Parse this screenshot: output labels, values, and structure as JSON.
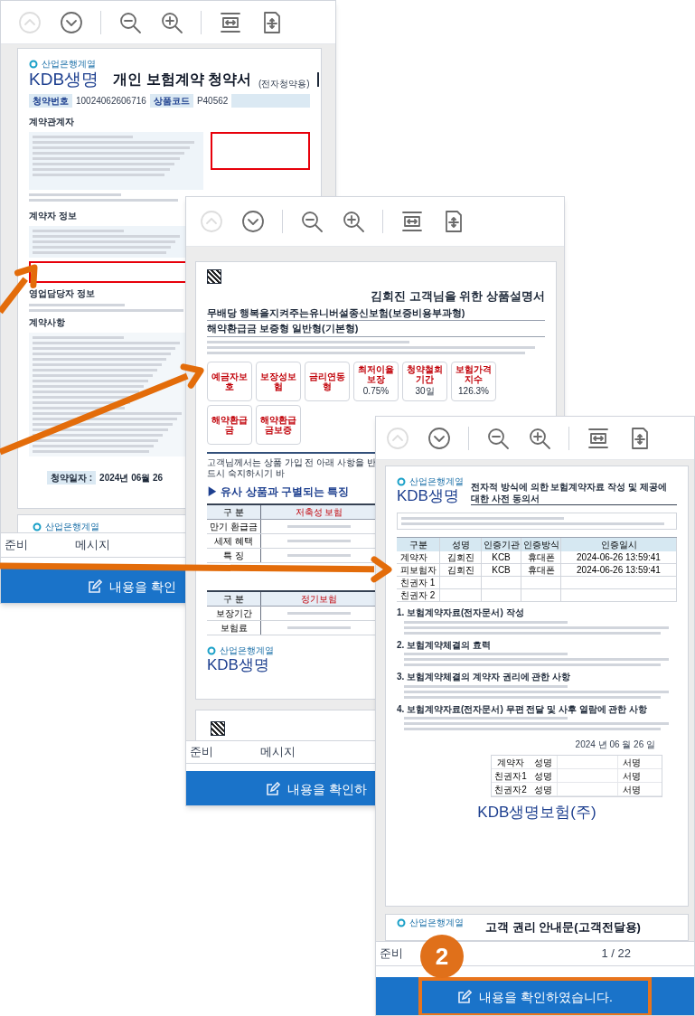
{
  "windows": [
    {
      "toolbar": [
        {
          "kind": "page-up",
          "disabled": true
        },
        {
          "kind": "page-down",
          "disabled": false
        },
        {
          "kind": "zoom-out",
          "disabled": false
        },
        {
          "kind": "zoom-in",
          "disabled": false
        },
        {
          "kind": "fit-width",
          "disabled": false
        },
        {
          "kind": "fit-page",
          "disabled": false
        }
      ],
      "document": {
        "kind": "application",
        "brand_group": "산업은행계열",
        "logo": "KDB생명",
        "title": "개인 보험계약 청약서",
        "subtitle": "(전자청약용)",
        "info": [
          {
            "label": "청약번호",
            "value": "10024062606716"
          },
          {
            "label": "상품코드",
            "value": "P40562"
          }
        ],
        "sections": [
          "계약관계자",
          "계약자 정보",
          "영업담당자 정보",
          "계약사항"
        ],
        "date_label": "청약일자 :",
        "date": "2024년 06월 26",
        "next_page_brand": "산업은행계열"
      },
      "status": {
        "left": "준비",
        "right": "메시지"
      },
      "confirm_button": {
        "label": "내용을 확인",
        "highlighted": false
      }
    },
    {
      "toolbar": [
        {
          "kind": "page-up",
          "disabled": true
        },
        {
          "kind": "page-down",
          "disabled": false
        },
        {
          "kind": "zoom-out",
          "disabled": false
        },
        {
          "kind": "zoom-in",
          "disabled": false
        },
        {
          "kind": "fit-width",
          "disabled": false
        },
        {
          "kind": "fit-page",
          "disabled": false
        }
      ],
      "document": {
        "kind": "explanation",
        "title": "김회진 고객님을 위한 상품설명서",
        "product": [
          "무배당 행복을지켜주는유니버설종신보험(보증비용부과형)",
          "해약환급금 보증형 일반형(기본형)"
        ],
        "tiles": [
          {
            "label": "예금자보호"
          },
          {
            "label": "보장성보험"
          },
          {
            "label": "금리연동형"
          },
          {
            "label": "최저이율보장",
            "value": "0.75%"
          },
          {
            "label": "청약철회기간",
            "value": "30일"
          },
          {
            "label": "보험가격지수",
            "value": "126.3%"
          },
          {
            "label": "해약환급금"
          },
          {
            "label": "해약환급금보증"
          }
        ],
        "notice": "고객님께서는 상품 가입 전 아래 사항을 반드시 숙지하시기 바",
        "feature_heading": "▶ 유사 상품과 구별되는 특징",
        "tables": [
          {
            "header": [
              "구 분",
              "저축성 보험"
            ],
            "rows": [
              "만기 환급금",
              "세제 혜택",
              "특 징"
            ]
          },
          {
            "header": [
              "구 분",
              "정기보험"
            ],
            "rows": [
              "보장기간",
              "보험료"
            ]
          }
        ],
        "footer_brand": "산업은행계열",
        "footer_logo": "KDB생명"
      },
      "status": {
        "left": "준비",
        "right": "메시지"
      },
      "confirm_button": {
        "label": "내용을 확인하",
        "highlighted": false
      }
    },
    {
      "toolbar": [
        {
          "kind": "page-up",
          "disabled": true
        },
        {
          "kind": "page-down",
          "disabled": false
        },
        {
          "kind": "zoom-out",
          "disabled": false
        },
        {
          "kind": "zoom-in",
          "disabled": false
        },
        {
          "kind": "fit-width",
          "disabled": false
        },
        {
          "kind": "fit-page",
          "disabled": false
        }
      ],
      "document": {
        "kind": "consent",
        "brand_group": "산업은행계열",
        "logo": "KDB생명",
        "title": "전자적 방식에 의한 보험계약자료 작성 및 제공에 대한 사전 동의서",
        "auth_table": {
          "header": [
            "구분",
            "성명",
            "인증기관",
            "인증방식",
            "인증일시"
          ],
          "rows": [
            {
              "role": "계약자",
              "cells": [
                "김회진",
                "KCB",
                "휴대폰",
                "2024-06-26 13:59:41"
              ]
            },
            {
              "role": "피보험자",
              "cells": [
                "김회진",
                "KCB",
                "휴대폰",
                "2024-06-26 13:59:41"
              ]
            },
            {
              "role": "친권자 1",
              "cells": []
            },
            {
              "role": "친권자 2",
              "cells": []
            }
          ]
        },
        "sections": [
          "1. 보험계약자료(전자문서) 작성",
          "2. 보험계약체결의 효력",
          "3. 보험계약체결의 계약자 권리에 관한 사항",
          "4. 보험계약자료(전자문서) 무편 전달 및 사후 열람에 관한 사항"
        ],
        "date": "2024 년 06 월 26 일",
        "signers": [
          {
            "role": "계약자",
            "name_label": "성명",
            "sign_label": "서명"
          },
          {
            "role": "친권자1",
            "name_label": "성명",
            "sign_label": "서명"
          },
          {
            "role": "친권자2",
            "name_label": "성명",
            "sign_label": "서명"
          }
        ],
        "company": "KDB생명보험(주)",
        "next_page_brand": "산업은행계열",
        "next_page_title": "고객 권리 안내문(고객전달용)"
      },
      "status": {
        "left": "준비",
        "right": "1 / 22"
      },
      "confirm_button": {
        "label": "내용을 확인하였습니다.",
        "highlighted": true
      }
    }
  ],
  "step_badge": "2"
}
